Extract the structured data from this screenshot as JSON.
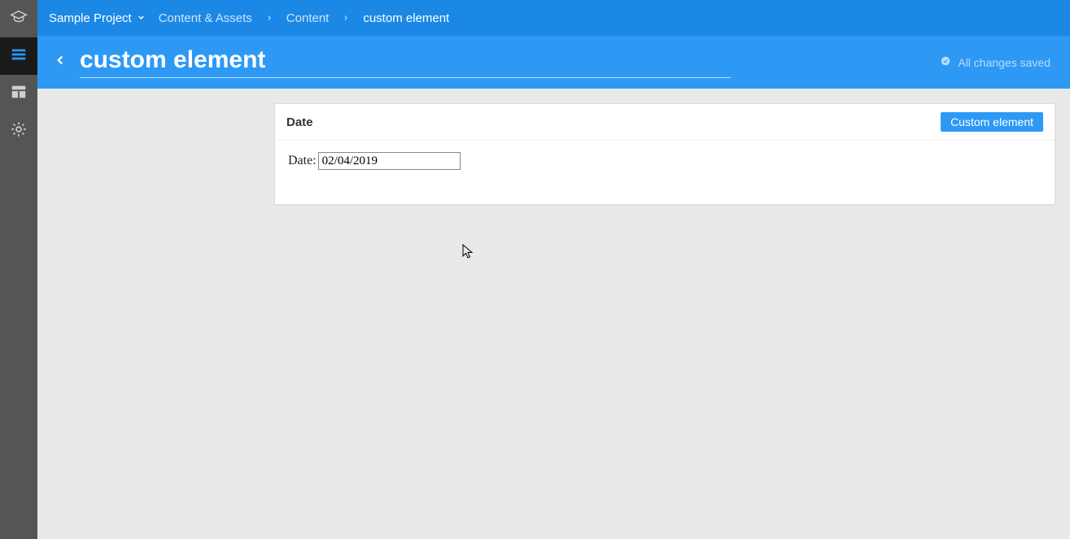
{
  "sidebar": {
    "items": [
      {
        "name": "graduation-cap-icon"
      },
      {
        "name": "content-list-icon"
      },
      {
        "name": "layout-icon"
      },
      {
        "name": "gear-icon"
      }
    ],
    "active_index": 1
  },
  "topbar": {
    "project": "Sample Project",
    "crumbs": [
      "Content & Assets",
      "Content",
      "custom element"
    ]
  },
  "titlebar": {
    "title": "custom element",
    "status": "All changes saved"
  },
  "card": {
    "title": "Date",
    "badge": "Custom element",
    "field_label": "Date:",
    "field_value": "02/04/2019"
  }
}
